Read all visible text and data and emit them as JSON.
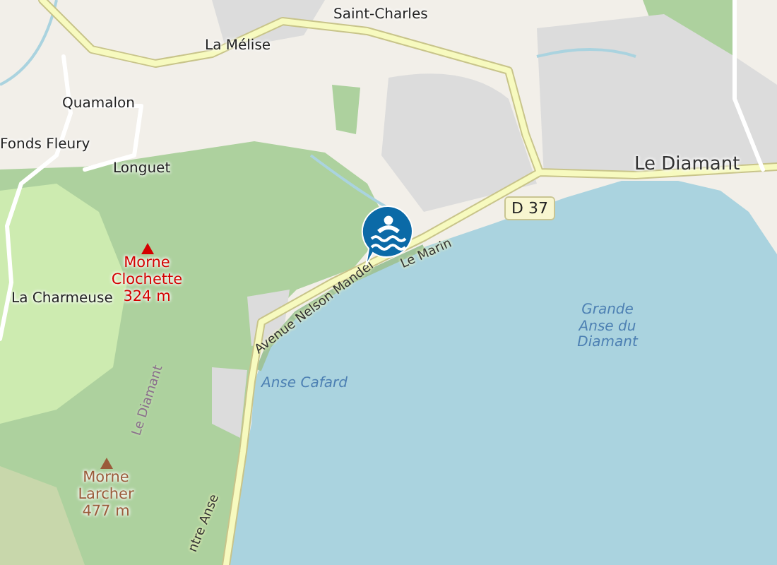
{
  "map": {
    "places": [
      {
        "name": "Saint-Charles",
        "kind": "hamlet"
      },
      {
        "name": "La Mélise",
        "kind": "hamlet"
      },
      {
        "name": "Quamalon",
        "kind": "hamlet"
      },
      {
        "name": "Fonds Fleury",
        "kind": "hamlet"
      },
      {
        "name": "Longuet",
        "kind": "hamlet"
      },
      {
        "name": "La Charmeuse",
        "kind": "hamlet"
      },
      {
        "name": "Le Diamant",
        "kind": "town"
      }
    ],
    "peaks": [
      {
        "name": "Morne Clochette",
        "elevation": "324 m",
        "color": "#d40000"
      },
      {
        "name": "Morne Larcher",
        "elevation": "477 m",
        "color": "#9a5b3a"
      }
    ],
    "water_labels": [
      {
        "name": "Anse Cafard"
      },
      {
        "name": "Grande Anse du Diamant"
      }
    ],
    "road_labels": [
      {
        "name": "Avenue Nelson Mandel",
        "kind": "street"
      },
      {
        "name": "Le Marin",
        "kind": "street"
      },
      {
        "name": "Le Diamant",
        "kind": "boundary"
      },
      {
        "name": "ntre Anse",
        "kind": "street"
      }
    ],
    "route_shield": "D 37",
    "marker": {
      "kind": "beach"
    }
  }
}
